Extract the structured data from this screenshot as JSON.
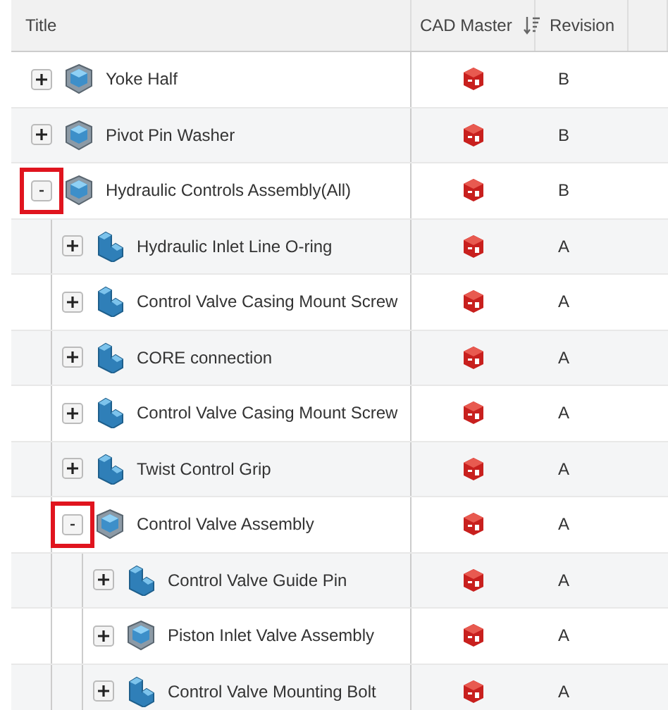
{
  "table": {
    "columns": [
      {
        "label": "Title",
        "sortable": false
      },
      {
        "label": "CAD Master",
        "sortable": true
      },
      {
        "label": "Revision",
        "sortable": false
      }
    ],
    "rows": [
      {
        "title": "Yoke Half",
        "kind": "assembly",
        "expanded": false,
        "highlighted": false,
        "revision": "B"
      },
      {
        "title": "Pivot Pin Washer",
        "kind": "assembly",
        "expanded": false,
        "highlighted": false,
        "revision": "B"
      },
      {
        "title": "Hydraulic Controls Assembly(All)",
        "kind": "assembly",
        "expanded": true,
        "highlighted": true,
        "revision": "B",
        "children": [
          {
            "title": "Hydraulic Inlet Line O-ring",
            "kind": "part",
            "expanded": false,
            "highlighted": false,
            "revision": "A"
          },
          {
            "title": "Control Valve Casing Mount Screw",
            "kind": "part",
            "expanded": false,
            "highlighted": false,
            "revision": "A"
          },
          {
            "title": "CORE connection",
            "kind": "part",
            "expanded": false,
            "highlighted": false,
            "revision": "A"
          },
          {
            "title": "Control Valve Casing Mount Screw",
            "kind": "part",
            "expanded": false,
            "highlighted": false,
            "revision": "A"
          },
          {
            "title": "Twist Control Grip",
            "kind": "part",
            "expanded": false,
            "highlighted": false,
            "revision": "A"
          },
          {
            "title": "Control Valve Assembly",
            "kind": "assembly",
            "expanded": true,
            "highlighted": true,
            "revision": "A",
            "children": [
              {
                "title": "Control Valve Guide Pin",
                "kind": "part",
                "expanded": false,
                "highlighted": false,
                "revision": "A"
              },
              {
                "title": "Piston Inlet Valve Assembly",
                "kind": "assembly",
                "expanded": false,
                "highlighted": false,
                "revision": "A"
              },
              {
                "title": "Control Valve Mounting Bolt",
                "kind": "part",
                "expanded": false,
                "highlighted": false,
                "revision": "A"
              }
            ]
          }
        ]
      }
    ]
  }
}
